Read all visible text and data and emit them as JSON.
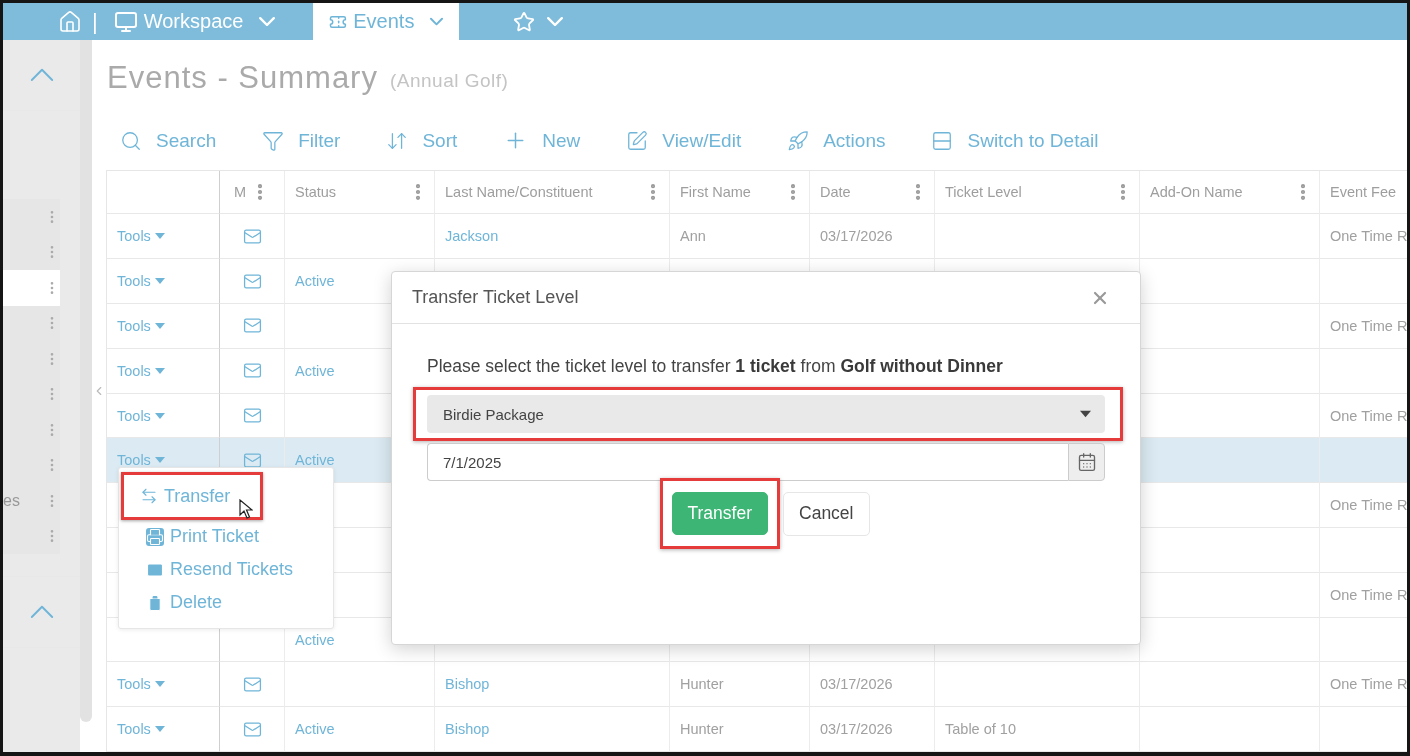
{
  "nav": {
    "separator": "|",
    "tabs": [
      {
        "kind": "monitor",
        "label": "Workspace",
        "selected": false
      },
      {
        "kind": "ticket",
        "label": "Events",
        "selected": true
      },
      {
        "kind": "star",
        "selected": false
      }
    ]
  },
  "sidebar": {
    "items": [
      {
        "selected": false
      },
      {
        "selected": false
      },
      {
        "selected": true
      },
      {
        "selected": false
      },
      {
        "selected": false
      },
      {
        "selected": false
      },
      {
        "selected": false
      },
      {
        "selected": false
      },
      {
        "label": "es",
        "selected": false
      },
      {
        "selected": false
      }
    ]
  },
  "page": {
    "title": "Events - Summary",
    "subtitle": "(Annual Golf)"
  },
  "toolbar": [
    {
      "kind": "search",
      "label": "Search"
    },
    {
      "kind": "filter",
      "label": "Filter"
    },
    {
      "kind": "sort",
      "label": "Sort"
    },
    {
      "kind": "new",
      "label": "New"
    },
    {
      "kind": "edit",
      "label": "View/Edit"
    },
    {
      "kind": "actions",
      "label": "Actions"
    },
    {
      "kind": "switch",
      "label": "Switch to Detail"
    }
  ],
  "table": {
    "columns": [
      {
        "label": "M",
        "menu": true
      },
      {
        "label": "Status",
        "menu": true
      },
      {
        "label": "Last Name/Constituent",
        "menu": true
      },
      {
        "label": "First Name",
        "menu": true
      },
      {
        "label": "Date",
        "menu": true
      },
      {
        "label": "Ticket Level",
        "menu": true
      },
      {
        "label": "Add-On Name",
        "menu": true
      },
      {
        "label": "Event Fee",
        "menu": false
      }
    ],
    "rows": [
      {
        "tools": "Tools",
        "last": "Jackson",
        "first": "Ann",
        "date": "03/17/2026",
        "fee": "One Time R",
        "selected": false
      },
      {
        "tools": "Tools",
        "status": "Active",
        "selected": false
      },
      {
        "tools": "Tools",
        "fee": "One Time R",
        "selected": false
      },
      {
        "tools": "Tools",
        "status": "Active",
        "selected": false
      },
      {
        "tools": "Tools",
        "fee": "One Time R",
        "selected": false
      },
      {
        "tools": "Tools",
        "status": "Active",
        "selected": true
      },
      {
        "fee": "One Time R",
        "selected": false
      },
      {
        "selected": false
      },
      {
        "fee": "One Time R",
        "selected": false
      },
      {
        "status": "Active",
        "selected": false
      },
      {
        "tools": "Tools",
        "last": "Bishop",
        "first": "Hunter",
        "date": "03/17/2026",
        "fee": "One Time R",
        "selected": false
      },
      {
        "tools": "Tools",
        "status": "Active",
        "last": "Bishop",
        "first": "Hunter",
        "date": "03/17/2026",
        "ticket": "Table of 10",
        "selected": false
      }
    ]
  },
  "tools_menu": {
    "items": [
      {
        "kind": "transfer",
        "label": "Transfer",
        "highlighted": true
      },
      {
        "kind": "print",
        "label": "Print Ticket",
        "highlighted": false
      },
      {
        "kind": "resend",
        "label": "Resend Tickets",
        "highlighted": false
      },
      {
        "kind": "delete",
        "label": "Delete",
        "highlighted": false
      }
    ]
  },
  "dialog": {
    "title": "Transfer Ticket Level",
    "message": "Please select the ticket level to transfer **1 ticket** from **Golf without Dinner**",
    "select": {
      "value": "Birdie Package",
      "highlighted": true
    },
    "date": {
      "value": "7/1/2025"
    },
    "buttons": [
      {
        "kind": "primary",
        "label": "Transfer",
        "highlighted": true
      },
      {
        "kind": "secondary",
        "label": "Cancel",
        "highlighted": false
      }
    ]
  }
}
